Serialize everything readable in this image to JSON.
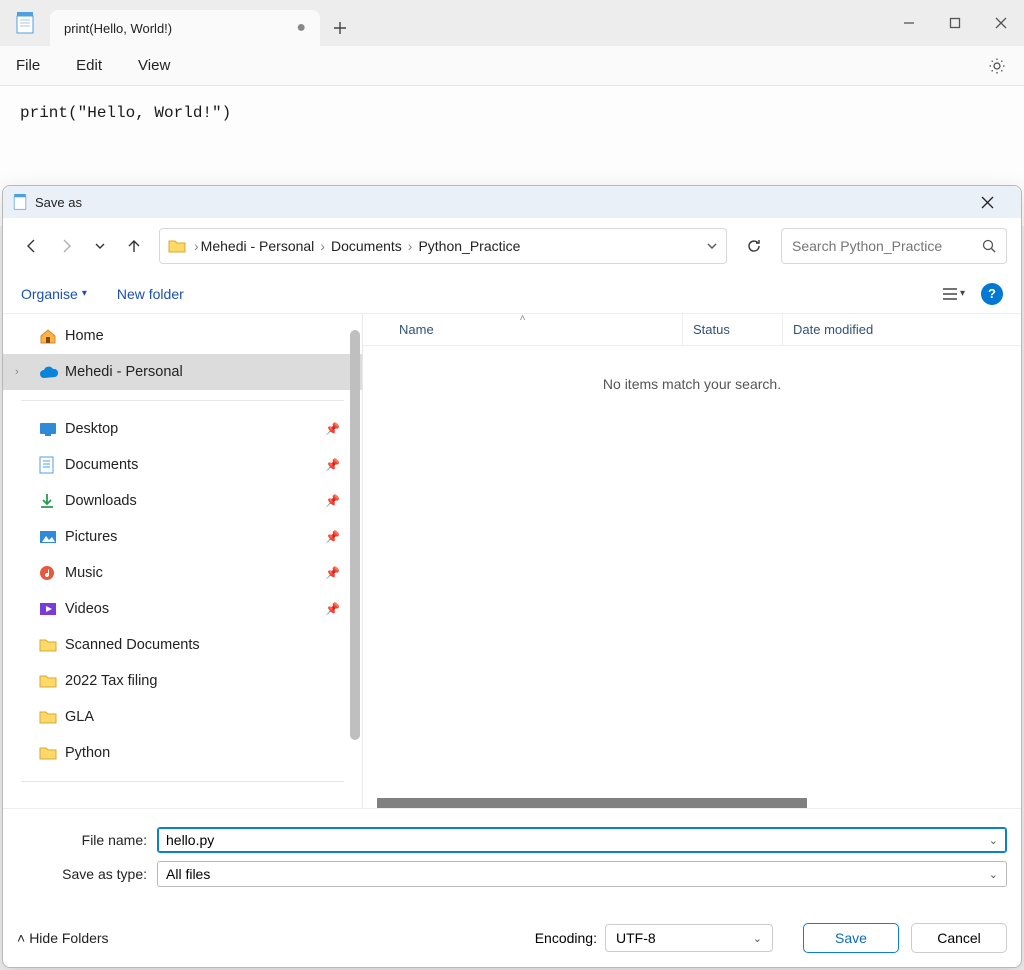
{
  "notepad": {
    "tab_title": "print(Hello, World!)",
    "menu": {
      "file": "File",
      "edit": "Edit",
      "view": "View"
    },
    "editor_content": "print(\"Hello, World!\")"
  },
  "dialog": {
    "title": "Save as",
    "breadcrumb": [
      "Mehedi - Personal",
      "Documents",
      "Python_Practice"
    ],
    "search_placeholder": "Search Python_Practice",
    "toolbar": {
      "organise": "Organise",
      "new_folder": "New folder"
    },
    "tree": {
      "home": "Home",
      "personal": "Mehedi - Personal",
      "desktop": "Desktop",
      "documents": "Documents",
      "downloads": "Downloads",
      "pictures": "Pictures",
      "music": "Music",
      "videos": "Videos",
      "scanned": "Scanned Documents",
      "tax": "2022 Tax filing",
      "gla": "GLA",
      "python": "Python"
    },
    "columns": {
      "name": "Name",
      "status": "Status",
      "date": "Date modified"
    },
    "empty_text": "No items match your search.",
    "filename_label": "File name:",
    "filename_value": "hello.py",
    "savetype_label": "Save as type:",
    "savetype_value": "All files",
    "hide_folders": "Hide Folders",
    "encoding_label": "Encoding:",
    "encoding_value": "UTF-8",
    "save_btn": "Save",
    "cancel_btn": "Cancel"
  }
}
